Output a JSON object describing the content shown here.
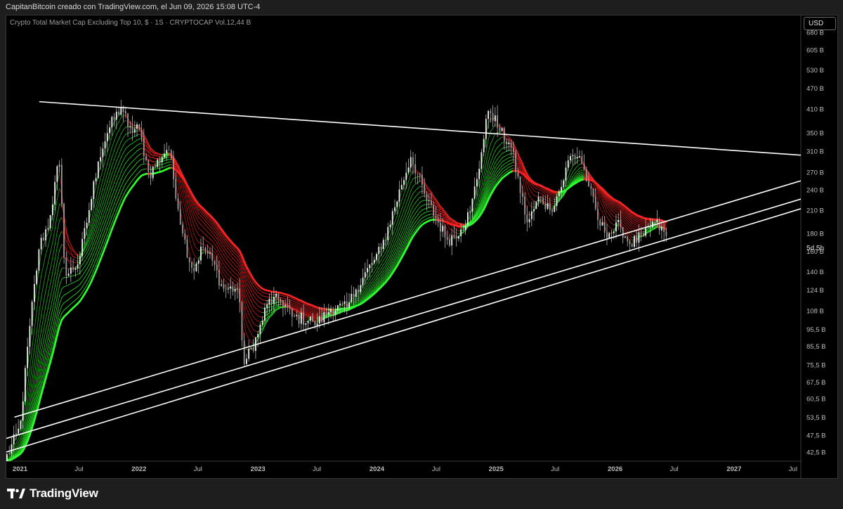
{
  "header": {
    "caption": "CapitanBitcoin creado con TradingView.com, el Jun 09, 2026 15:08 UTC-4"
  },
  "legend": {
    "text": "Crypto Total Market Cap Excluding Top 10, $ · 1S · CRYPTOCAP  Vol.12,44 B"
  },
  "scale_button": {
    "label": "USD"
  },
  "countdown": "5d 5h",
  "footer": {
    "brand": "TradingView",
    "logo_icon": "tradingview-logo-icon"
  },
  "colors": {
    "background": "#000000",
    "bull": "#2cff2c",
    "bear": "#ff2222",
    "candle": "#d8d8d8",
    "trendline": "#ffffff",
    "axis_text": "#bdbdbd"
  },
  "chart_data": {
    "type": "line",
    "scale": "log",
    "y_unit": "B USD",
    "ylim": [
      40,
      760
    ],
    "xlim": [
      "2020-11-20",
      "2027-07-25"
    ],
    "y_tick_labels": [
      "680 B",
      "605 B",
      "530 B",
      "470 B",
      "410 B",
      "350 B",
      "310 B",
      "270 B",
      "240 B",
      "210 B",
      "180 B",
      "160 B",
      "140 B",
      "124 B",
      "108 B",
      "95,5 B",
      "85,5 B",
      "75,5 B",
      "67,5 B",
      "60,5 B",
      "53,5 B",
      "47,5 B",
      "42,5 B"
    ],
    "y_tick_values": [
      680,
      605,
      530,
      470,
      410,
      350,
      310,
      270,
      240,
      210,
      180,
      160,
      140,
      124,
      108,
      95.5,
      85.5,
      75.5,
      67.5,
      60.5,
      53.5,
      47.5,
      42.5
    ],
    "x_tick_labels": [
      "2021",
      "Jul",
      "2022",
      "Jul",
      "2023",
      "Jul",
      "2024",
      "Jul",
      "2025",
      "Jul",
      "2026",
      "Jul",
      "2027",
      "Jul"
    ],
    "x_tick_dates": [
      "2021-01-01",
      "2021-07-01",
      "2022-01-01",
      "2022-07-01",
      "2023-01-01",
      "2023-07-01",
      "2024-01-01",
      "2024-07-01",
      "2025-01-01",
      "2025-07-01",
      "2026-01-01",
      "2026-07-01",
      "2027-01-01",
      "2027-07-01"
    ],
    "last_value": 176,
    "price_series": {
      "name": "",
      "x": [
        "2020-11-15",
        "2021-01-01",
        "2021-02-01",
        "2021-03-01",
        "2021-04-01",
        "2021-05-01",
        "2021-05-20",
        "2021-07-01",
        "2021-08-01",
        "2021-09-01",
        "2021-10-01",
        "2021-11-10",
        "2021-12-01",
        "2022-01-01",
        "2022-02-01",
        "2022-04-01",
        "2022-05-15",
        "2022-06-15",
        "2022-07-15",
        "2022-08-15",
        "2022-09-15",
        "2022-11-01",
        "2022-11-20",
        "2022-12-31",
        "2023-02-01",
        "2023-03-15",
        "2023-04-15",
        "2023-06-15",
        "2023-07-01",
        "2023-08-15",
        "2023-10-01",
        "2023-11-01",
        "2023-12-15",
        "2024-01-15",
        "2024-03-15",
        "2024-04-15",
        "2024-06-01",
        "2024-08-05",
        "2024-09-15",
        "2024-10-15",
        "2024-11-15",
        "2024-12-10",
        "2025-01-15",
        "2025-02-15",
        "2025-04-07",
        "2025-05-15",
        "2025-06-15",
        "2025-07-20",
        "2025-08-15",
        "2025-09-15",
        "2025-10-15",
        "2025-11-15",
        "2025-12-15",
        "2026-01-15",
        "2026-02-15",
        "2026-04-01",
        "2026-05-01",
        "2026-06-09"
      ],
      "y": [
        40,
        50,
        100,
        165,
        195,
        295,
        135,
        150,
        210,
        300,
        360,
        420,
        355,
        360,
        265,
        320,
        180,
        140,
        165,
        150,
        125,
        125,
        76,
        92,
        115,
        116,
        104,
        101,
        99,
        110,
        110,
        126,
        147,
        163,
        245,
        300,
        225,
        172,
        185,
        210,
        300,
        415,
        350,
        320,
        192,
        230,
        210,
        245,
        300,
        300,
        240,
        190,
        180,
        190,
        168,
        178,
        195,
        176
      ]
    },
    "ema_ribbon": {
      "name": "",
      "bull_color": "#2cff2c",
      "bear_color": "#ff2222",
      "note_colors": "green when price above ribbon, red when below",
      "bands": 14
    },
    "trendlines": [
      {
        "x": [
          "2021-03-01",
          "2027-07-25"
        ],
        "y": [
          430,
          302
        ]
      },
      {
        "x": [
          "2020-12-15",
          "2027-07-25"
        ],
        "y": [
          53.5,
          255
        ]
      },
      {
        "x": [
          "2020-11-20",
          "2027-07-25"
        ],
        "y": [
          46.5,
          226
        ]
      },
      {
        "x": [
          "2020-11-20",
          "2027-07-25"
        ],
        "y": [
          42.5,
          212
        ]
      }
    ]
  }
}
